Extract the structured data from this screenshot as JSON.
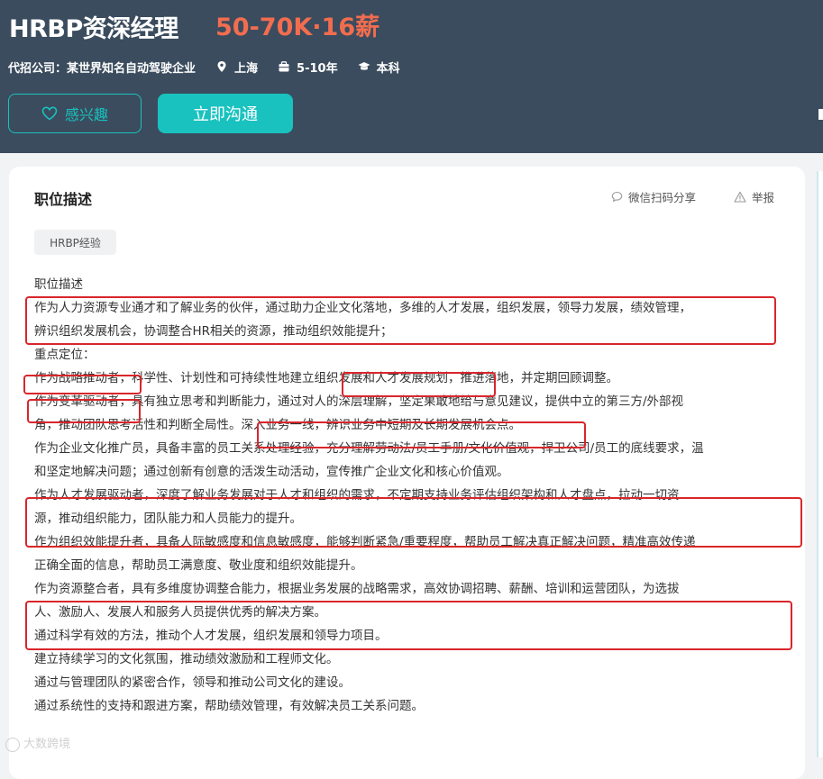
{
  "header": {
    "job_title": "HRBP资深经理",
    "salary": "50-70K·16薪",
    "company": "代招公司：某世界知名自动驾驶企业",
    "location": "上海",
    "experience": "5-10年",
    "education": "本科",
    "interest_button": "感兴趣",
    "chat_button": "立即沟通",
    "icons": [
      "location-pin-icon",
      "briefcase-icon",
      "graduation-cap-icon",
      "heart-icon"
    ],
    "colors": {
      "accent": "#19c2bf",
      "salary": "#f26d4f",
      "header_bg": "#3b4c5e",
      "highlight_box": "#d9262b"
    }
  },
  "card": {
    "title": "职位描述",
    "share": "微信扫码分享",
    "report": "举报",
    "tag": "HRBP经验",
    "lines": [
      "职位描述",
      "作为人力资源专业通才和了解业务的伙伴，通过助力企业文化落地，多维的人才发展，组织发展，领导力发展，绩效管理，",
      "辨识组织发展机会，协调整合HR相关的资源，推动组织效能提升；",
      "重点定位：",
      "作为战略推动者，科学性、计划性和可持续性地建立组织发展和人才发展规划，推进落地，并定期回顾调整。",
      "作为变革驱动者，具有独立思考和判断能力，通过对人的深层理解，坚定果敢地给与意见建议，提供中立的第三方/外部视",
      "角，推动团队思考活性和判断全局性。深入业务一线，辨识业务中短期及长期发展机会点。",
      "作为企业文化推广员，具备丰富的员工关系处理经验，充分理解劳动法/员工手册/文化价值观，捍卫公司/员工的底线要求，温",
      "和坚定地解决问题；通过创新有创意的活泼生动活动，宣传推广企业文化和核心价值观。",
      "作为人才发展驱动者，深度了解业务发展对于人才和组织的需求，不定期支持业务评估组织架构和人才盘点，拉动一切资",
      "源，推动组织能力，团队能力和人员能力的提升。",
      "作为组织效能提升者，具备人际敏感度和信息敏感度，能够判断紧急/重要程度，帮助员工解决真正解决问题，精准高效传递",
      "正确全面的信息，帮助员工满意度、敬业度和组织效能提升。",
      "作为资源整合者，具有多维度协调整合能力，根据业务发展的战略需求，高效协调招聘、薪酬、培训和运营团队，为选拔",
      "人、激励人、发展人和服务人员提供优秀的解决方案。",
      "通过科学有效的方法，推动个人才发展，组织发展和领导力项目。",
      "建立持续学习的文化氛围，推动绩效激励和工程师文化。",
      "通过与管理团队的紧密合作，领导和推动公司文化的建设。",
      "通过系统性的支持和跟进方案，帮助绩效管理，有效解决员工关系问题。"
    ]
  },
  "watermark": "大数跨境"
}
